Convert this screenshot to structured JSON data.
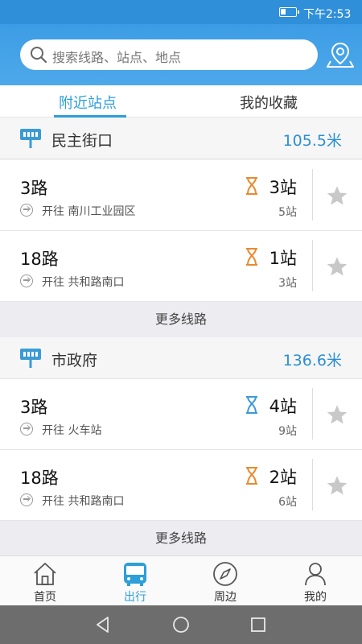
{
  "status_bar": {
    "time": "下午2:53"
  },
  "search": {
    "placeholder": "搜索线路、站点、地点"
  },
  "tabs": [
    {
      "label": "附近站点",
      "active": true
    },
    {
      "label": "我的收藏",
      "active": false
    }
  ],
  "stops": [
    {
      "name": "民主街口",
      "distance": "105.5米",
      "routes": [
        {
          "name": "3路",
          "direction": "开往 南川工业园区",
          "eta": "3站",
          "total": "5站",
          "eta_color": "#e98a2e"
        },
        {
          "name": "18路",
          "direction": "开往 共和路南口",
          "eta": "1站",
          "total": "3站",
          "eta_color": "#e98a2e"
        }
      ],
      "more": "更多线路"
    },
    {
      "name": "市政府",
      "distance": "136.6米",
      "routes": [
        {
          "name": "3路",
          "direction": "开往 火车站",
          "eta": "4站",
          "total": "9站",
          "eta_color": "#3a9bd5"
        },
        {
          "name": "18路",
          "direction": "开往 共和路南口",
          "eta": "2站",
          "total": "6站",
          "eta_color": "#e98a2e"
        }
      ],
      "more": "更多线路"
    }
  ],
  "bottom_nav": [
    {
      "label": "首页",
      "icon": "home-icon",
      "active": false
    },
    {
      "label": "出行",
      "icon": "bus-icon",
      "active": true
    },
    {
      "label": "周边",
      "icon": "compass-icon",
      "active": false
    },
    {
      "label": "我的",
      "icon": "user-icon",
      "active": false
    }
  ],
  "colors": {
    "accent": "#2d9fd9",
    "header": "#3c9ce5",
    "orange": "#e98a2e"
  }
}
